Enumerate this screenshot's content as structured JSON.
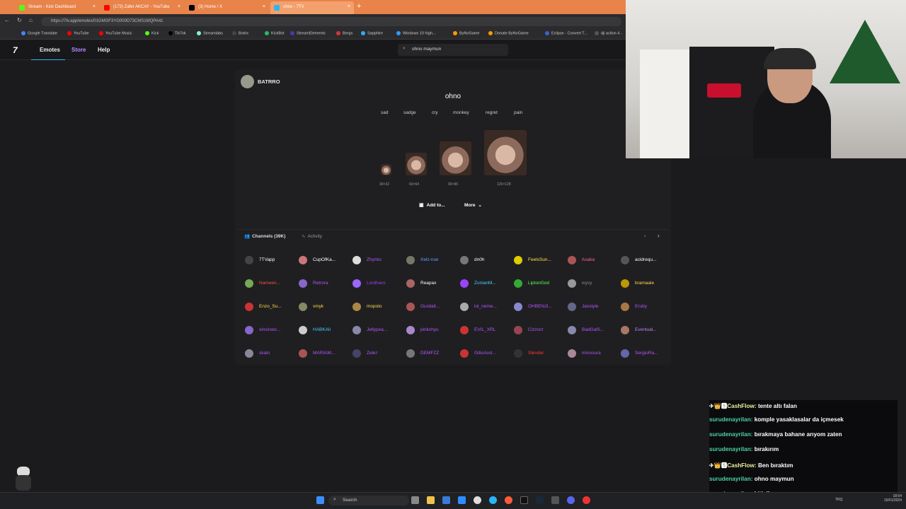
{
  "browser": {
    "tabs": [
      {
        "label": "Stream - Kick Dashboard",
        "color": "#53fc18"
      },
      {
        "label": "(173) Zafer AKCAY - YouTube",
        "color": "#ff0000"
      },
      {
        "label": "(3) Home / X",
        "color": "#000000"
      },
      {
        "label": "ohno - 7TV",
        "color": "#29b6f6",
        "active": true
      }
    ],
    "new_tab": "+",
    "close": "×",
    "address": "https://7tv.app/emotes/01GMGF3YG000D73CMS1MQPA41",
    "bookmarks": [
      "Google Translate",
      "YouTube",
      "YouTube Music",
      "Kick",
      "TikTok",
      "Streamlabs",
      "Botrix",
      "KickBot",
      "StreamElements",
      "Bergs",
      "Sapphire",
      "Windows 10 high...",
      "ByNoGame",
      "Donate ByNoGame",
      "Eclipse - Convert T...",
      "dji action 4 -"
    ]
  },
  "nav": {
    "logo": "7",
    "links": [
      "Emotes",
      "Store",
      "Help"
    ],
    "search_value": "ohno maymun"
  },
  "emote": {
    "owner": "BATRRO",
    "name": "ohno",
    "tags": [
      "sad",
      "sadge",
      "cry",
      "monkey",
      "regret",
      "pain"
    ],
    "sizes": [
      "30×32",
      "60×64",
      "90×96",
      "120×128"
    ],
    "add_label": "Add to...",
    "more_label": "More"
  },
  "channels": {
    "tab_channels": "Channels (39K)",
    "tab_activity": "Activity",
    "list": [
      {
        "name": "7TVapp",
        "color": "#ffffff",
        "av": "#444"
      },
      {
        "name": "CupOfKa...",
        "color": "#ffffff",
        "av": "#c77"
      },
      {
        "name": "Zhynks",
        "color": "#b455ff",
        "av": "#ddd"
      },
      {
        "name": "Xelz-ruw",
        "color": "#6aa0ff",
        "av": "#776"
      },
      {
        "name": "dn0h",
        "color": "#ffffff",
        "av": "#777"
      },
      {
        "name": "FeelsSun...",
        "color": "#ffe04a",
        "av": "#dc0"
      },
      {
        "name": "Asaka",
        "color": "#ff5fa0",
        "av": "#a55"
      },
      {
        "name": "acidrequ...",
        "color": "#ffffff",
        "av": "#555"
      },
      {
        "name": "Nameen...",
        "color": "#ff4a4a",
        "av": "#7a5"
      },
      {
        "name": "Retrora",
        "color": "#b455ff",
        "av": "#86c"
      },
      {
        "name": "Lordhavs",
        "color": "#a23cff",
        "av": "#96f"
      },
      {
        "name": "Reapax",
        "color": "#ffffff",
        "av": "#a66"
      },
      {
        "name": "ZonianM...",
        "color": "#3fd0ff",
        "av": "#94f"
      },
      {
        "name": "LiptonGod",
        "color": "#5cff5c",
        "av": "#3a3"
      },
      {
        "name": "wysy",
        "color": "#888888",
        "av": "#999"
      },
      {
        "name": "bramaale",
        "color": "#ffd84a",
        "av": "#b90"
      },
      {
        "name": "Enzo_Su...",
        "color": "#ffd84a",
        "av": "#c33"
      },
      {
        "name": "vmyk",
        "color": "#ffd84a",
        "av": "#886"
      },
      {
        "name": "mopolo",
        "color": "#ffd84a",
        "av": "#a84"
      },
      {
        "name": "Gustlall...",
        "color": "#b455ff",
        "av": "#a55"
      },
      {
        "name": "lol_neme...",
        "color": "#b455ff",
        "av": "#aaa"
      },
      {
        "name": "OHBENJI...",
        "color": "#b455ff",
        "av": "#88c"
      },
      {
        "name": "Jaxstyle",
        "color": "#b455ff",
        "av": "#668"
      },
      {
        "name": "Eruby",
        "color": "#b455ff",
        "av": "#a74"
      },
      {
        "name": "xinxinwo...",
        "color": "#b455ff",
        "av": "#86c"
      },
      {
        "name": "HABKAll",
        "color": "#3fd0ff",
        "av": "#ccc"
      },
      {
        "name": "Jellypea...",
        "color": "#b455ff",
        "av": "#88a"
      },
      {
        "name": "pinkchyu",
        "color": "#b455ff",
        "av": "#a8c"
      },
      {
        "name": "EVIL_XRL",
        "color": "#b455ff",
        "av": "#c33"
      },
      {
        "name": "Cizzorz",
        "color": "#b455ff",
        "av": "#945"
      },
      {
        "name": "BadGalS...",
        "color": "#b455ff",
        "av": "#88a"
      },
      {
        "name": "Eventual...",
        "color": "#c080ff",
        "av": "#a76"
      },
      {
        "name": "skain",
        "color": "#b455ff",
        "av": "#889"
      },
      {
        "name": "MARIAM...",
        "color": "#b455ff",
        "av": "#a55"
      },
      {
        "name": "Zeleт",
        "color": "#b455ff",
        "av": "#446"
      },
      {
        "name": "DEMFZZ",
        "color": "#b455ff",
        "av": "#777"
      },
      {
        "name": "GibsAnd...",
        "color": "#b455ff",
        "av": "#c33"
      },
      {
        "name": "Slender",
        "color": "#ff3b3b",
        "av": "#333"
      },
      {
        "name": "minosura",
        "color": "#b455ff",
        "av": "#a89"
      },
      {
        "name": "SergioRa...",
        "color": "#b455ff",
        "av": "#66a"
      }
    ]
  },
  "chat": [
    {
      "prefix": "✈👑🆂",
      "user": "CashFlow",
      "cf": true,
      "text": "tente altı falan"
    },
    {
      "prefix": "",
      "user": "surudenayrilan",
      "cf": false,
      "text": "komple yasaklasalar da içmesek"
    },
    {
      "prefix": "",
      "user": "surudenayrilan",
      "cf": false,
      "text": "bırakmaya bahane arıyom zaten"
    },
    {
      "prefix": "",
      "user": "surudenayrilan",
      "cf": false,
      "text": "bırakırım"
    },
    {
      "prefix": "✈👑🆂",
      "user": "CashFlow",
      "cf": true,
      "text": "Ben bıraktım"
    },
    {
      "prefix": "",
      "user": "surudenayrilan",
      "cf": false,
      "text": "ohno maymun"
    },
    {
      "prefix": "",
      "user": "surudenayrilan",
      "cf": false,
      "text": "bitişik yaz"
    }
  ],
  "taskbar": {
    "search": "Search",
    "tray_lang": "TRQ",
    "time": "18:54",
    "date": "15/01/2024"
  }
}
